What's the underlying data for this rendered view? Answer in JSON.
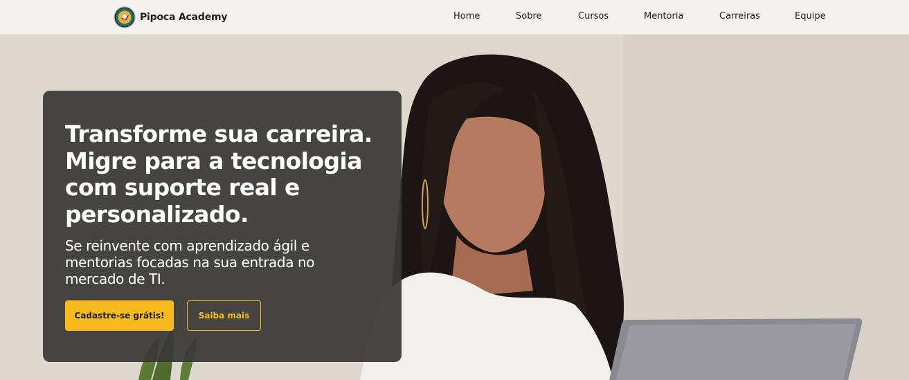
{
  "navbar": {
    "brand_name": "Pipoca Academy",
    "links": [
      {
        "label": "Home"
      },
      {
        "label": "Sobre"
      },
      {
        "label": "Cursos"
      },
      {
        "label": "Mentoria"
      },
      {
        "label": "Carreiras"
      },
      {
        "label": "Equipe"
      }
    ]
  },
  "hero": {
    "title": "Transforme sua carreira. Migre para a tecnologia com suporte real e personalizado.",
    "subtitle": "Se reinvente com aprendizado ágil e mentorias focadas na sua entrada no mercado de TI.",
    "primary_button": "Cadastre-se grátis!",
    "secondary_button": "Saiba mais"
  },
  "colors": {
    "accent": "#f7bb1d",
    "card_background": "#3a3836",
    "navbar_background": "#f5f3f0"
  },
  "icons": {
    "brand_logo": "pipoca-academy-logo-icon"
  }
}
